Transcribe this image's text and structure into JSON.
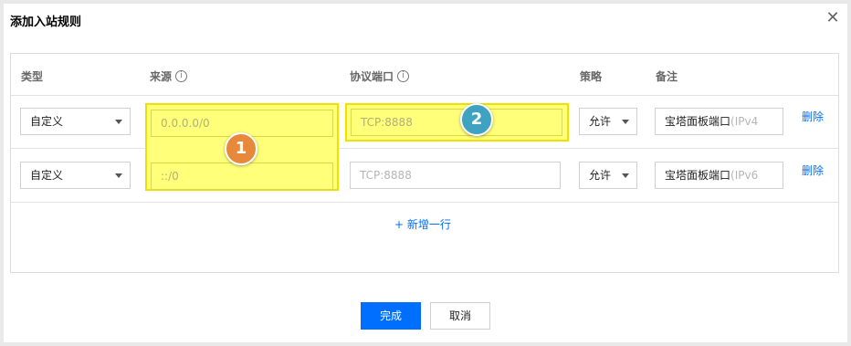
{
  "dialog": {
    "title": "添加入站规则",
    "close_label": "✕"
  },
  "table": {
    "headers": {
      "type": "类型",
      "source": "来源",
      "port": "协议端口",
      "policy": "策略",
      "note": "备注"
    },
    "rows": [
      {
        "type": "自定义",
        "source_placeholder": "0.0.0.0/0",
        "port_placeholder": "TCP:8888",
        "policy": "允许",
        "note_prefix": "宝塔面板端口",
        "note_hint": "(IPv4",
        "delete": "删除"
      },
      {
        "type": "自定义",
        "source_placeholder": "::/0",
        "port_placeholder": "TCP:8888",
        "policy": "允许",
        "note_prefix": "宝塔面板端口",
        "note_hint": "(IPv6",
        "delete": "删除"
      }
    ],
    "add_row": "+ 新增一行"
  },
  "annotations": {
    "badge1": "1",
    "badge2": "2",
    "badge1_color": "#e8883a",
    "badge2_color": "#3fa2c0",
    "highlight_color": "#ffff7a"
  },
  "footer": {
    "confirm": "完成",
    "cancel": "取消"
  }
}
